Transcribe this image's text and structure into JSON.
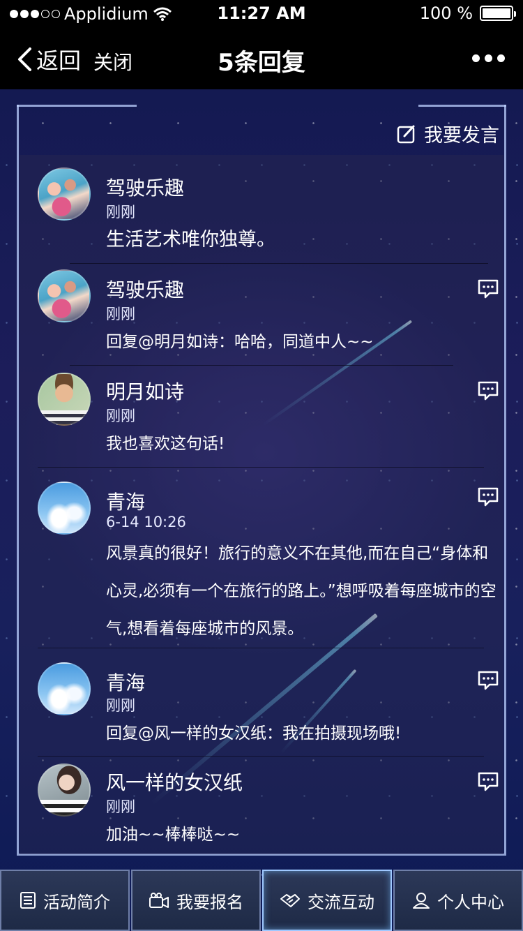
{
  "status_bar": {
    "carrier": "Applidium",
    "time": "11:27 AM",
    "battery": "100 %",
    "battery_level": 1.0,
    "signal_bars_filled": 3,
    "signal_bars_total": 5
  },
  "nav": {
    "back_label": "返回",
    "close_label": "关闭",
    "title": "5条回复"
  },
  "post_button": {
    "label": "我要发言"
  },
  "comments": [
    {
      "name": "驾驶乐趣",
      "time": "刚刚",
      "text": "生活艺术唯你独尊。"
    },
    {
      "name": "驾驶乐趣",
      "time": "刚刚",
      "text": "回复@明月如诗：哈哈，同道中人~~"
    },
    {
      "name": "明月如诗",
      "time": "刚刚",
      "text": "我也喜欢这句话!"
    },
    {
      "name": "青海",
      "time": "6-14 10:26",
      "text": "风景真的很好！旅行的意义不在其他,而在自己“身体和心灵,必须有一个在旅行的路上。”想呼吸着每座城市的空气,想看着每座城市的风景。"
    },
    {
      "name": "青海",
      "time": "刚刚",
      "text": "回复@风一样的女汉纸：我在拍摄现场哦!"
    },
    {
      "name": "风一样的女汉纸",
      "time": "刚刚",
      "text": "加油~~棒棒哒~~"
    }
  ],
  "tabs": [
    {
      "label": "活动简介",
      "icon": "list-icon"
    },
    {
      "label": "我要报名",
      "icon": "camera-icon"
    },
    {
      "label": "交流互动",
      "icon": "handshake-icon"
    },
    {
      "label": "个人中心",
      "icon": "user-icon"
    }
  ],
  "colors": {
    "background": "#141a52",
    "frame": "#bed2ff",
    "tab_background": "#2c3858",
    "tab_active_border": "#9fc8ff"
  }
}
